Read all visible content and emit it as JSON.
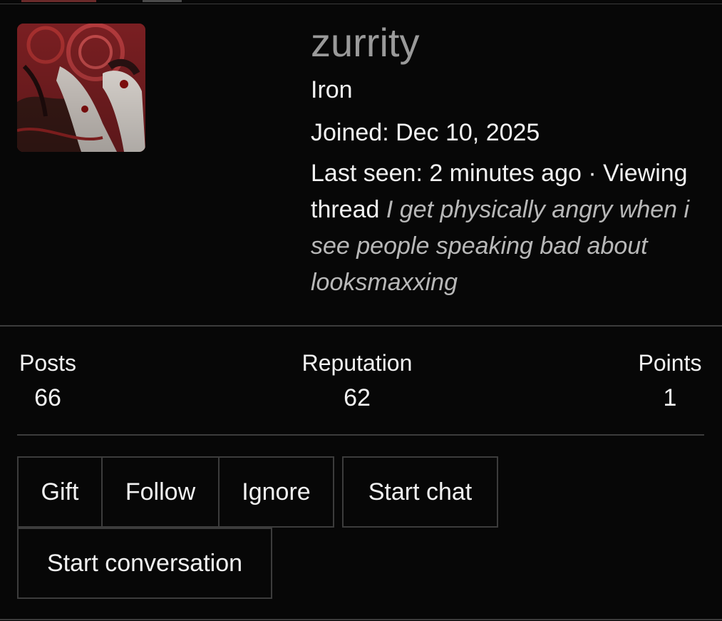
{
  "profile": {
    "username": "zurrity",
    "rank": "Iron",
    "joined": "Joined: Dec 10, 2025",
    "last_seen_prefix": "Last seen: 2 minutes ago · Viewing thread ",
    "thread_title": "I get physically angry when i see people speaking bad about looksmaxxing"
  },
  "stats": {
    "posts_label": "Posts",
    "posts_value": "66",
    "reputation_label": "Reputation",
    "reputation_value": "62",
    "points_label": "Points",
    "points_value": "1"
  },
  "actions": {
    "gift": "Gift",
    "follow": "Follow",
    "ignore": "Ignore",
    "start_chat": "Start chat",
    "start_conversation": "Start conversation"
  },
  "colors": {
    "background": "#070707",
    "username": "#9a9a9a",
    "border": "#3c3c3c",
    "thread_text": "#b8b8b8"
  }
}
